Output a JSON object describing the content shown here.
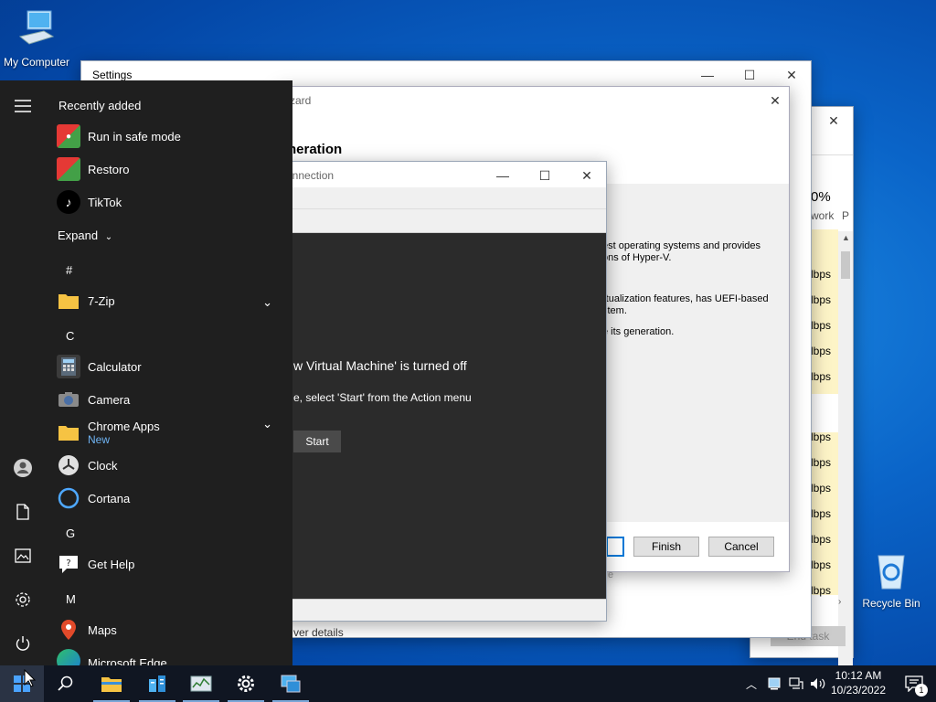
{
  "desktop": {
    "my_computer": "My Computer",
    "recycle_bin": "Recycle Bin"
  },
  "task_manager": {
    "column_pct": "0%",
    "column_label": "work",
    "column_p": "P",
    "rows": [
      "lbps",
      "lbps",
      "lbps",
      "lbps",
      "lbps",
      "lbps",
      "lbps",
      "lbps",
      "lbps",
      "lbps",
      "lbps",
      "lbps",
      "lbps"
    ],
    "footer_left": "ver details",
    "end_task": "End task"
  },
  "settings": {
    "title": "Settings"
  },
  "wizard": {
    "title_fragment": "zard",
    "heading_fragment": "neration",
    "line1": "est operating systems and provides",
    "line2": "ons of Hyper-V.",
    "line3": "rtualization features, has UEFI-based",
    "line4": "stem.",
    "line5": "e its generation.",
    "finish": "Finish",
    "cancel": "Cancel",
    "footer_fragment": "e"
  },
  "vm_connection": {
    "title_fragment": "onnection",
    "status": "w Virtual Machine' is turned off",
    "hint": "e, select 'Start' from the Action menu",
    "start": "Start"
  },
  "start_menu": {
    "recently_added": "Recently added",
    "apps_recent": [
      "Run in safe mode",
      "Restoro",
      "TikTok"
    ],
    "expand": "Expand",
    "letters": [
      "#",
      "C",
      "G",
      "M"
    ],
    "apps": {
      "zip": "7-Zip",
      "calculator": "Calculator",
      "camera": "Camera",
      "chrome_apps": "Chrome Apps",
      "chrome_apps_badge": "New",
      "clock": "Clock",
      "cortana": "Cortana",
      "get_help": "Get Help",
      "maps": "Maps",
      "edge": "Microsoft Edge"
    }
  },
  "taskbar": {
    "time": "10:12 AM",
    "date": "10/23/2022",
    "notification_count": "1"
  },
  "colors": {
    "accent_blue": "#0078d7",
    "start_bg": "#1f1f1f",
    "taskbar_bg": "#101622"
  }
}
